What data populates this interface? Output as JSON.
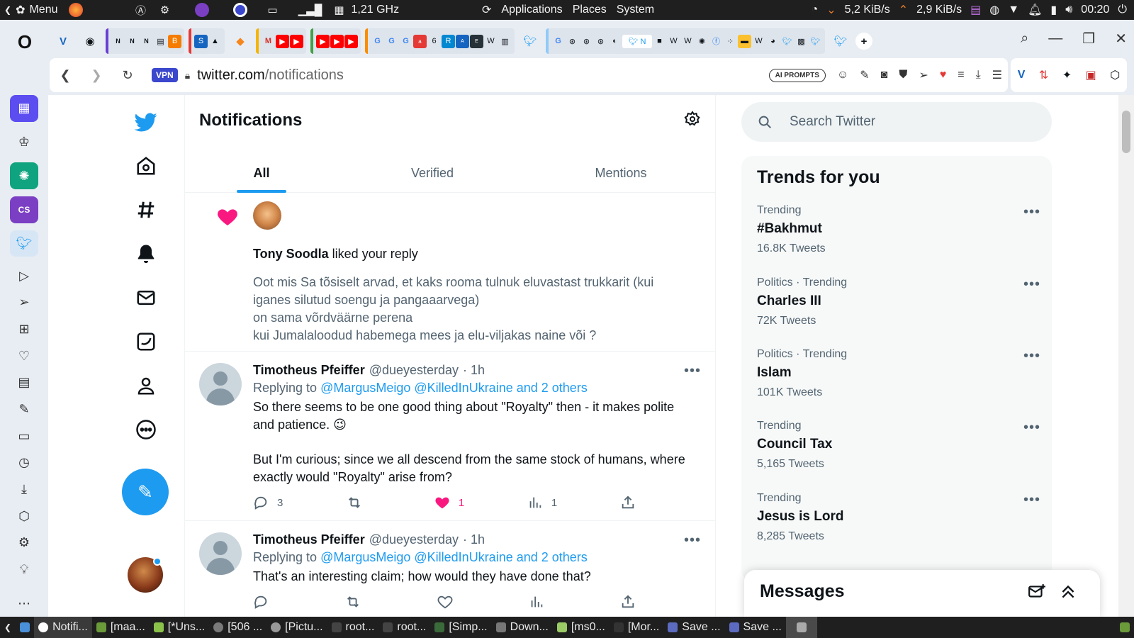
{
  "system_panel": {
    "menu_label": "Menu",
    "cpu_freq": "1,21 GHz",
    "menus": [
      "Applications",
      "Places",
      "System"
    ],
    "net_down": "5,2 KiB/s",
    "net_up": "2,9 KiB/s",
    "clock": "00:20"
  },
  "browser": {
    "vpn_label": "VPN",
    "url_host": "twitter.com",
    "url_path": "/notifications",
    "ai_prompts_label": "AI PROMPTS"
  },
  "page": {
    "title": "Notifications",
    "tabs": [
      {
        "label": "All"
      },
      {
        "label": "Verified"
      },
      {
        "label": "Mentions"
      }
    ]
  },
  "like_notification": {
    "user": "Tony Soodla",
    "action": " liked your reply",
    "quote": "Oot mis Sa tõsiselt arvad, et kaks rooma tulnuk eluvastast  trukkarit (kui iganes silutud soengu ja pangaaarvega)\non sama võrdväärne perena\nkui Jumalaloodud   habemega mees ja elu-viljakas naine või ?"
  },
  "tweets": [
    {
      "name": "Timotheus Pfeiffer",
      "handle": "@dueyesterday",
      "time": "· 1h",
      "replying_prefix": "Replying to ",
      "replying_to": "@MargusMeigo @KilledInUkraine and 2 others",
      "text1": "So there seems to be one good thing about \"Royalty\" then - it makes polite and patience. 😉",
      "text2": "But I'm curious; since we all descend from the same stock of humans, where exactly would \"Royalty\" arise from?",
      "replies": "3",
      "retweets": "",
      "likes": "1",
      "views": "1"
    },
    {
      "name": "Timotheus Pfeiffer",
      "handle": "@dueyesterday",
      "time": "· 1h",
      "replying_prefix": "Replying to ",
      "replying_to": "@MargusMeigo @KilledInUkraine and 2 others",
      "text1": "That's an interesting claim; how would they have done that?"
    }
  ],
  "search": {
    "placeholder": "Search Twitter"
  },
  "trends": {
    "title": "Trends for you",
    "items": [
      {
        "context": "Trending",
        "name": "#Bakhmut",
        "count": "16.8K Tweets"
      },
      {
        "context": "Politics · Trending",
        "name": "Charles III",
        "count": "72K Tweets"
      },
      {
        "context": "Politics · Trending",
        "name": "Islam",
        "count": "101K Tweets"
      },
      {
        "context": "Trending",
        "name": "Council Tax",
        "count": "5,165 Tweets"
      },
      {
        "context": "Trending",
        "name": "Jesus is Lord",
        "count": "8,285 Tweets"
      }
    ]
  },
  "messages": {
    "title": "Messages"
  },
  "taskbar": {
    "items": [
      "Notifi...",
      "[maa...",
      "[*Uns...",
      "[506 ...",
      "[Pictu...",
      "root...",
      "root...",
      "[Simp...",
      "Down...",
      "[ms0...",
      "[Mor...",
      "Save ...",
      "Save ..."
    ]
  },
  "colors": {
    "accent": "#1d9bf0",
    "like": "#f91880",
    "vpn": "#3b47cc"
  }
}
